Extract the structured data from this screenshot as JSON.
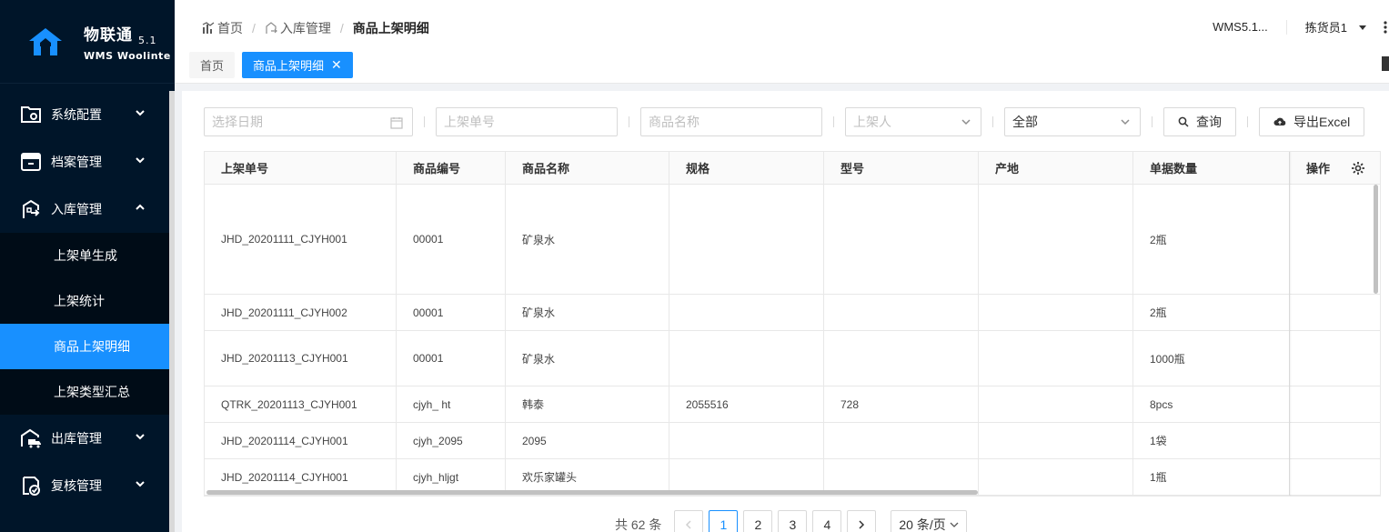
{
  "app": {
    "logo_title": "物联通",
    "logo_version": "5.1",
    "logo_subtitle": "WMS Woolinte"
  },
  "sidebar": {
    "items": [
      {
        "label": "系统配置",
        "icon": "gear-folder-icon"
      },
      {
        "label": "档案管理",
        "icon": "archive-icon"
      },
      {
        "label": "入库管理",
        "icon": "inbound-icon"
      },
      {
        "label": "出库管理",
        "icon": "outbound-truck-icon"
      },
      {
        "label": "复核管理",
        "icon": "review-check-icon"
      }
    ],
    "sub_items": [
      "上架单生成",
      "上架统计",
      "商品上架明细",
      "上架类型汇总"
    ],
    "active_sub": "商品上架明细"
  },
  "header": {
    "breadcrumb": [
      "首页",
      "入库管理",
      "商品上架明细"
    ],
    "version": "WMS5.1...",
    "user": "拣货员1",
    "tabs": [
      "首页",
      "商品上架明细"
    ]
  },
  "filters": {
    "date_placeholder": "选择日期",
    "order_placeholder": "上架单号",
    "name_placeholder": "商品名称",
    "person_placeholder": "上架人",
    "status_value": "全部",
    "query_label": "查询",
    "export_label": "导出Excel"
  },
  "table": {
    "columns": [
      "上架单号",
      "商品编号",
      "商品名称",
      "规格",
      "型号",
      "产地",
      "单据数量",
      "操作"
    ],
    "rows": [
      [
        "JHD_20201111_CJYH001",
        "00001",
        "矿泉水",
        "",
        "",
        "",
        "2瓶"
      ],
      [
        "JHD_20201111_CJYH002",
        "00001",
        "矿泉水",
        "",
        "",
        "",
        "2瓶"
      ],
      [
        "JHD_20201113_CJYH001",
        "00001",
        "矿泉水",
        "",
        "",
        "",
        "1000瓶"
      ],
      [
        "QTRK_20201113_CJYH001",
        "cjyh_ ht",
        "韩泰",
        "2055516",
        "728",
        "",
        "8pcs"
      ],
      [
        "JHD_20201114_CJYH001",
        "cjyh_2095",
        "2095",
        "",
        "",
        "",
        "1袋"
      ],
      [
        "JHD_20201114_CJYH001",
        "cjyh_hljgt",
        "欢乐家罐头",
        "",
        "",
        "",
        "1瓶"
      ]
    ]
  },
  "pagination": {
    "total": "共 62 条",
    "pages": [
      "1",
      "2",
      "3",
      "4"
    ],
    "current": "1",
    "page_size": "20 条/页"
  },
  "colors": {
    "sidebar_bg": "#001529",
    "accent": "#1890ff"
  }
}
